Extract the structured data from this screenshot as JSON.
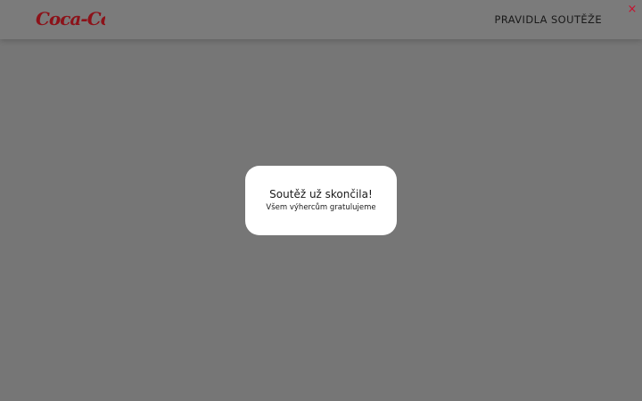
{
  "header": {
    "logo_text": "Coca-Cola",
    "rules_link_label": "PRAVIDLA SOUTĚŽE",
    "close_icon": "close-icon",
    "close_glyph": "×"
  },
  "modal": {
    "title": "Soutěž už skončila!",
    "subtitle": "Všem výhercům gratulujeme"
  },
  "colors": {
    "overlay": "#767676",
    "brand_red": "#8c1219",
    "close_red": "#c8102e",
    "modal_bg": "#ffffff"
  }
}
